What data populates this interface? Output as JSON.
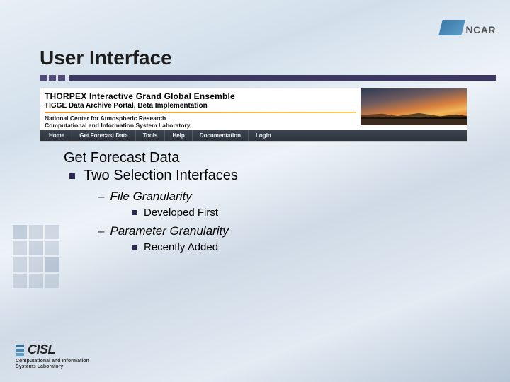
{
  "logo_top": {
    "text": "NCAR"
  },
  "title": "User Interface",
  "banner": {
    "title1": "THORPEX Interactive Grand Global Ensemble",
    "title2": "TIGGE Data Archive Portal, Beta Implementation",
    "sub1": "National Center for Atmospheric Research",
    "sub2": "Computational and Information System Laboratory",
    "nav": [
      "Home",
      "Get Forecast Data",
      "Tools",
      "Help",
      "Documentation",
      "Login"
    ]
  },
  "content": {
    "heading": "Get Forecast Data",
    "bullet": "Two Selection Interfaces",
    "items": [
      {
        "label": "File Granularity",
        "note": "Developed First"
      },
      {
        "label": "Parameter Granularity",
        "note": "Recently Added"
      }
    ]
  },
  "logo_bottom": {
    "text": "CISL",
    "sub1": "Computational and Information",
    "sub2": "Systems Laboratory"
  }
}
